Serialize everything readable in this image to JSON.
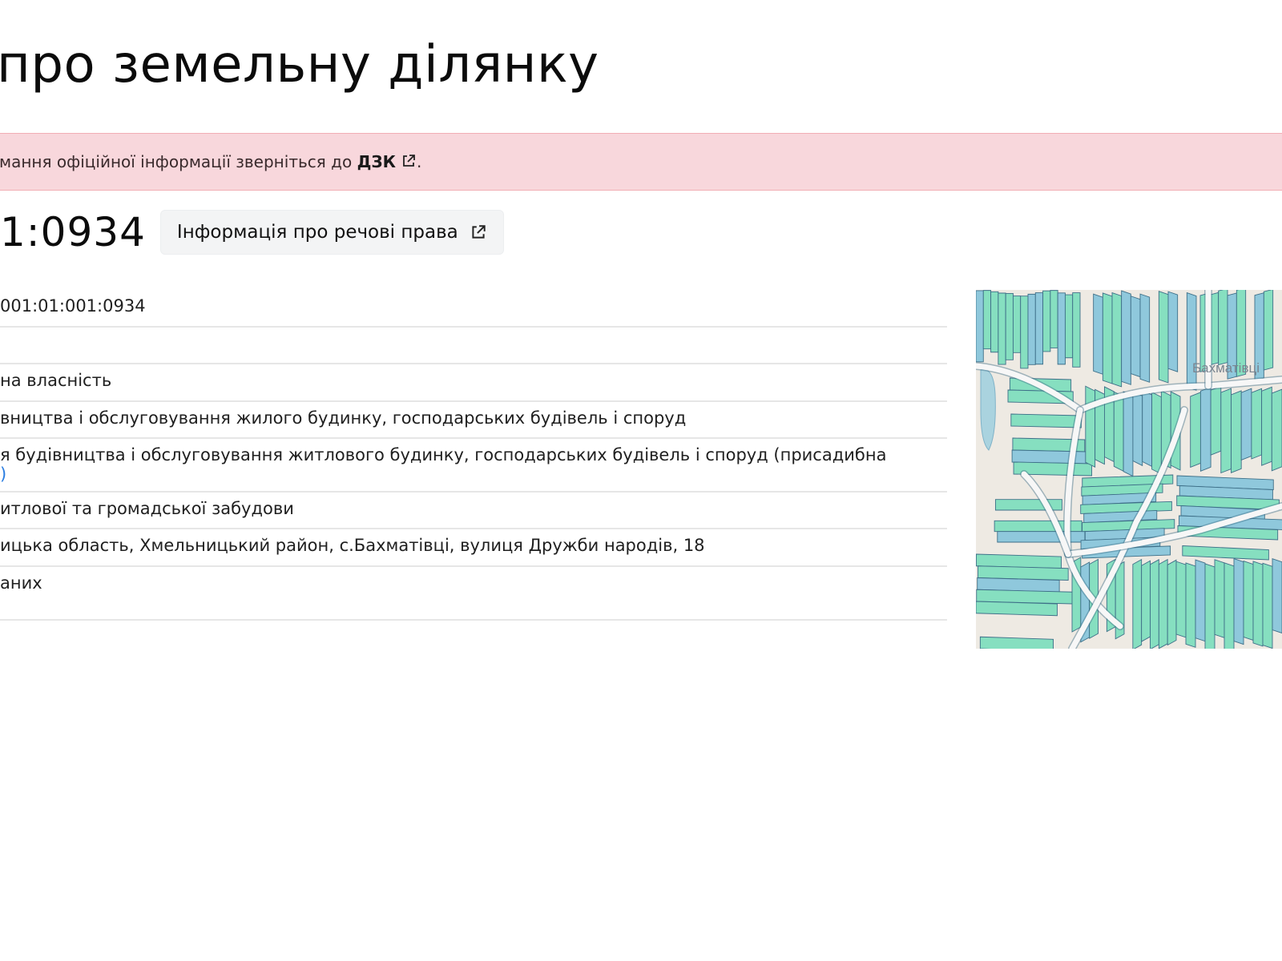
{
  "header": {
    "title_visible": "про земельну ділянку"
  },
  "alert": {
    "text_prefix": "мання офіційної інформації зверніться до ",
    "link_label": "ДЗК",
    "text_suffix": "."
  },
  "parcel": {
    "cadastral_number_visible": "1:0934",
    "rights_button_label": "Інформація про речові права"
  },
  "info_rows": [
    {
      "value": "001:01:001:0934"
    },
    {
      "value": ""
    },
    {
      "value": "на власність"
    },
    {
      "value": "вництва і обслуговування жилого будинку, господарських будівель і споруд"
    },
    {
      "value_line1": "я будівництва і обслуговування житлового будинку, господарських будівель і споруд (присадибна",
      "value_line2_mark": ")"
    },
    {
      "value": "итлової та громадської забудови"
    },
    {
      "value": "ицька область, Хмельницький район, с.Бахматівці, вулиця Дружби народів, 18"
    },
    {
      "value": "аних"
    }
  ],
  "map": {
    "place_label": "Бахматівці",
    "colors": {
      "parcel_green": "#86dfc0",
      "parcel_blue": "#8fc8dc",
      "parcel_stroke": "#3e6f88",
      "road": "#f7f7f7",
      "background": "#eeeae3",
      "water": "#aad3df"
    }
  },
  "colors": {
    "alert_bg": "#f8d7dc",
    "alert_border": "#f1aeb5",
    "divider": "#e6e6e6",
    "button_bg": "#f3f4f5"
  }
}
